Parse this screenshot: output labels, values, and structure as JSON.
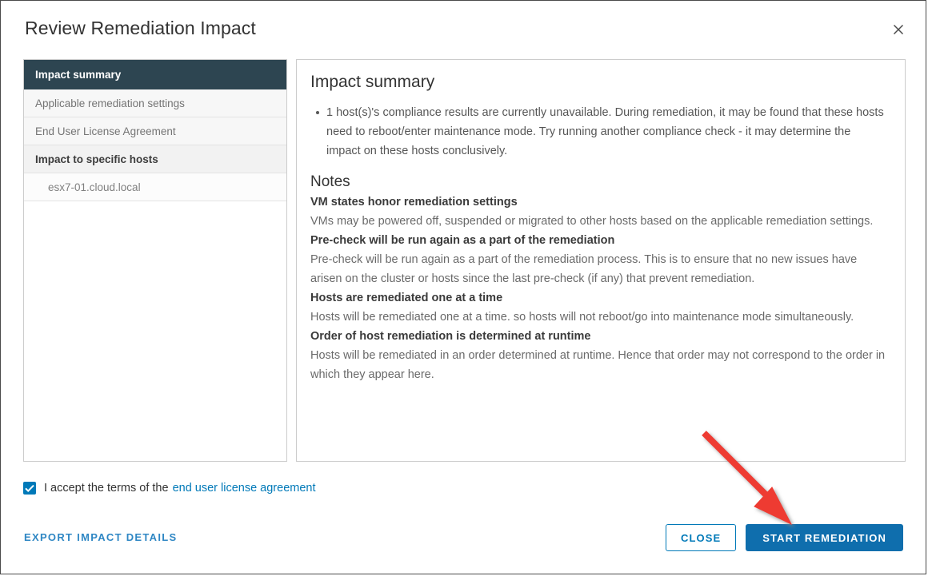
{
  "dialog": {
    "title": "Review Remediation Impact",
    "close_icon": "close-icon"
  },
  "sidebar": {
    "items": [
      {
        "label": "Impact summary",
        "state": "selected"
      },
      {
        "label": "Applicable remediation settings",
        "state": "normal"
      },
      {
        "label": "End User License Agreement",
        "state": "normal"
      },
      {
        "label": "Impact to specific hosts",
        "state": "group-header"
      },
      {
        "label": "esx7-01.cloud.local",
        "state": "child"
      }
    ]
  },
  "content": {
    "title": "Impact summary",
    "bullets": [
      "1 host(s)'s compliance results are currently unavailable. During remediation, it may be found that these hosts need to reboot/enter maintenance mode. Try running another compliance check - it may determine the impact on these hosts conclusively."
    ],
    "notes_title": "Notes",
    "notes": [
      {
        "heading": "VM states honor remediation settings",
        "body": "VMs may be powered off, suspended or migrated to other hosts based on the applicable remediation settings."
      },
      {
        "heading": "Pre-check will be run again as a part of the remediation",
        "body": "Pre-check will be run again as a part of the remediation process. This is to ensure that no new issues have arisen on the cluster or hosts since the last pre-check (if any) that prevent remediation."
      },
      {
        "heading": "Hosts are remediated one at a time",
        "body": "Hosts will be remediated one at a time. so hosts will not reboot/go into maintenance mode simultaneously."
      },
      {
        "heading": "Order of host remediation is determined at runtime",
        "body": "Hosts will be remediated in an order determined at runtime. Hence that order may not correspond to the order in which they appear here."
      }
    ]
  },
  "footer": {
    "accept_text": "I accept the terms of the",
    "eula_link": "end user license agreement",
    "checkbox_checked": true,
    "export_label": "Export Impact Details",
    "close_label": "Close",
    "start_label": "Start Remediation"
  },
  "annotation": {
    "arrow_color": "#ee3b33",
    "points_to": "start-remediation-button"
  },
  "colors": {
    "accent": "#0079b8",
    "primary_button": "#0f6ead",
    "sidebar_selected": "#2d4551",
    "arrow": "#ee3b33"
  }
}
